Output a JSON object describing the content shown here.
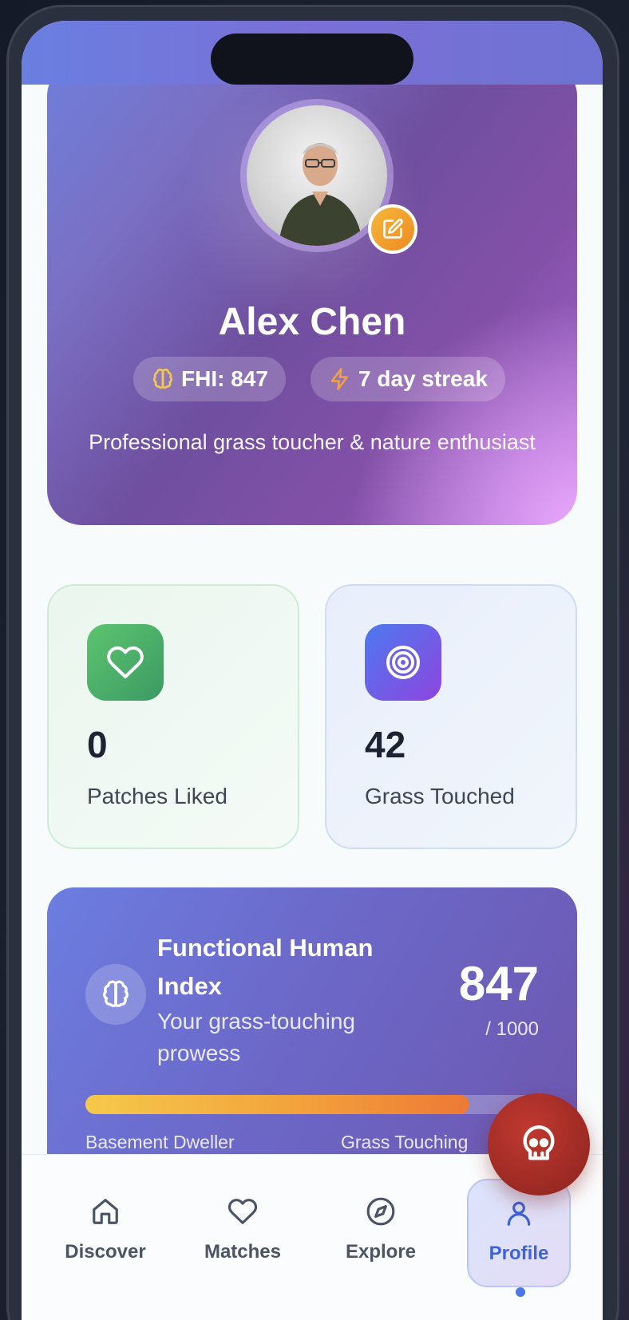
{
  "profile": {
    "name": "Alex Chen",
    "fhi_badge": "FHI: 847",
    "streak_badge": "7 day streak",
    "bio": "Professional grass toucher & nature enthusiast"
  },
  "stats": [
    {
      "value": "0",
      "label": "Patches Liked",
      "icon": "heart-icon"
    },
    {
      "value": "42",
      "label": "Grass Touched",
      "icon": "target-icon"
    }
  ],
  "fhi": {
    "title": "Functional Human Index",
    "subtitle": "Your grass-touching prowess",
    "score": "847",
    "max": "/ 1000",
    "progress": 0.847,
    "scale_low": "Basement Dweller",
    "scale_high": "Grass Touching"
  },
  "nav": {
    "items": [
      {
        "label": "Discover",
        "icon": "home-icon"
      },
      {
        "label": "Matches",
        "icon": "heart-icon"
      },
      {
        "label": "Explore",
        "icon": "compass-icon"
      },
      {
        "label": "Profile",
        "icon": "user-icon"
      }
    ],
    "active": "Profile"
  },
  "colors": {
    "accent": "#3e63d8",
    "fab": "#a82b25",
    "badge": "#f0a22d"
  }
}
